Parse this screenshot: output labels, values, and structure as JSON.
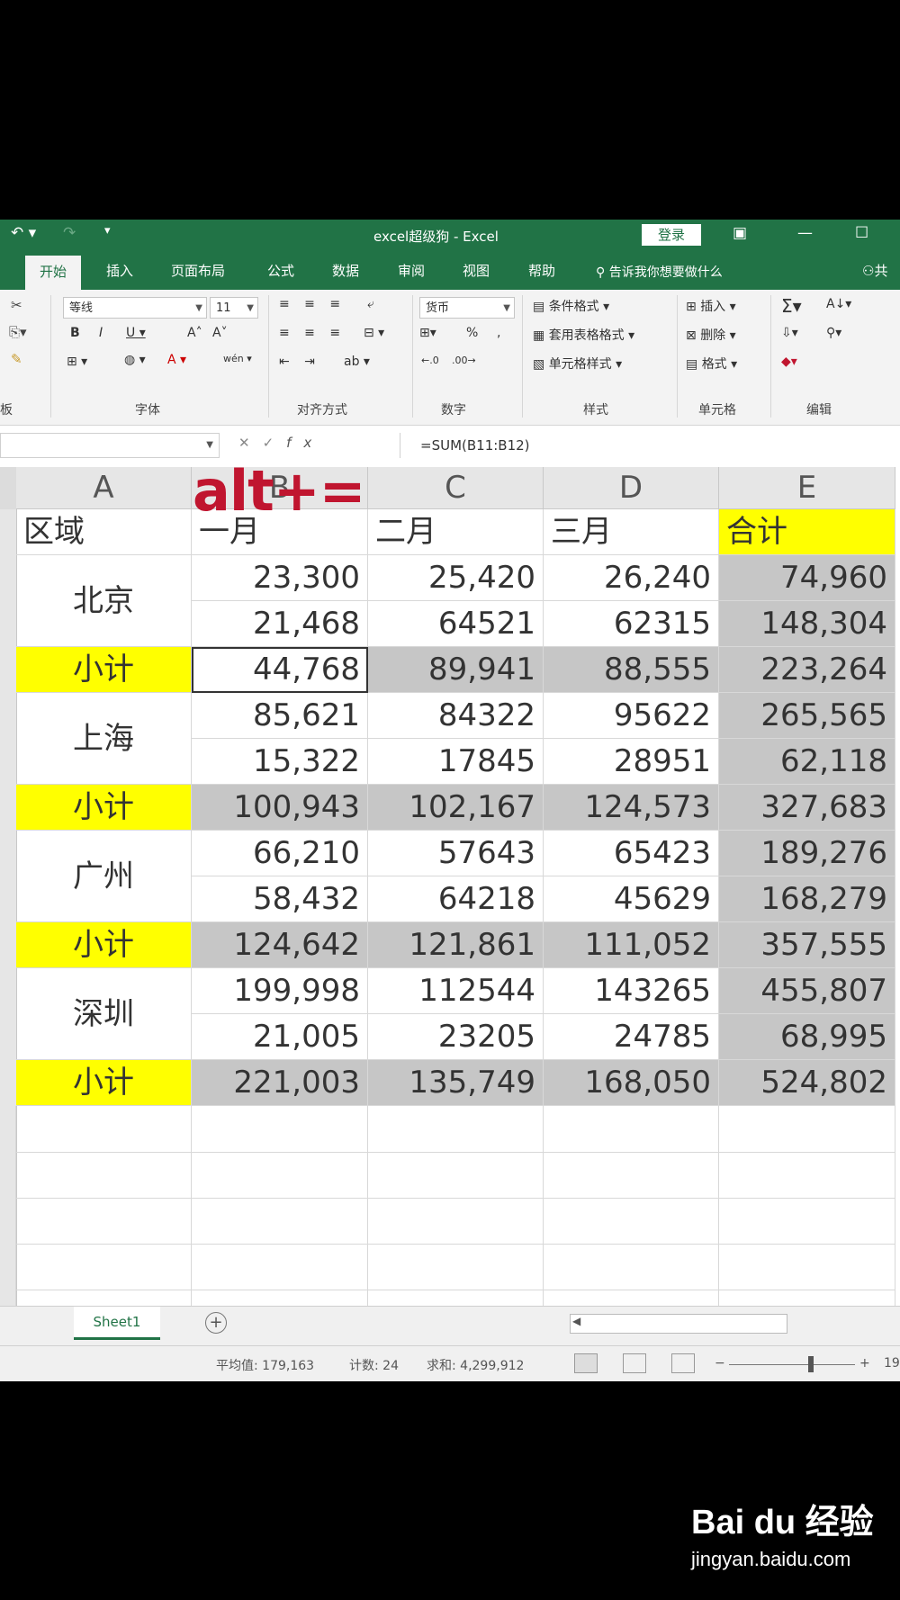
{
  "window": {
    "title": "excel超级狗 - Excel",
    "login": "登录"
  },
  "ribbon_tabs": [
    "开始",
    "插入",
    "页面布局",
    "公式",
    "数据",
    "审阅",
    "视图",
    "帮助"
  ],
  "tell_me": "告诉我你想要做什么",
  "share_fragment": "共",
  "ribbon": {
    "font_name": "等线",
    "font_size": "11",
    "number_format": "货币",
    "styles": [
      "条件格式",
      "套用表格格式",
      "单元格样式"
    ],
    "cells": [
      "插入",
      "删除",
      "格式"
    ],
    "group_labels": [
      "板",
      "字体",
      "对齐方式",
      "数字",
      "样式",
      "单元格",
      "编辑"
    ]
  },
  "formula_bar": {
    "formula": "=SUM(B11:B12)"
  },
  "shortcut_label": "alt+=",
  "grid": {
    "columns": [
      "A",
      "B",
      "C",
      "D",
      "E"
    ],
    "header_row": [
      "区域",
      "一月",
      "二月",
      "三月",
      "合计"
    ],
    "groups": [
      {
        "region": "北京",
        "rows": [
          [
            "23,300",
            "25,420",
            "26,240",
            "74,960"
          ],
          [
            "21,468",
            "64521",
            "62315",
            "148,304"
          ]
        ],
        "subtotal_label": "小计",
        "subtotal": [
          "44,768",
          "89,941",
          "88,555",
          "223,264"
        ]
      },
      {
        "region": "上海",
        "rows": [
          [
            "85,621",
            "84322",
            "95622",
            "265,565"
          ],
          [
            "15,322",
            "17845",
            "28951",
            "62,118"
          ]
        ],
        "subtotal_label": "小计",
        "subtotal": [
          "100,943",
          "102,167",
          "124,573",
          "327,683"
        ]
      },
      {
        "region": "广州",
        "rows": [
          [
            "66,210",
            "57643",
            "65423",
            "189,276"
          ],
          [
            "58,432",
            "64218",
            "45629",
            "168,279"
          ]
        ],
        "subtotal_label": "小计",
        "subtotal": [
          "124,642",
          "121,861",
          "111,052",
          "357,555"
        ]
      },
      {
        "region": "深圳",
        "rows": [
          [
            "199,998",
            "112544",
            "143265",
            "455,807"
          ],
          [
            "21,005",
            "23205",
            "24785",
            "68,995"
          ]
        ],
        "subtotal_label": "小计",
        "subtotal": [
          "221,003",
          "135,749",
          "168,050",
          "524,802"
        ]
      }
    ]
  },
  "sheet_tab": "Sheet1",
  "status": {
    "average": "平均值: 179,163",
    "count": "计数: 24",
    "sum": "求和: 4,299,912",
    "zoom_fragment": "19"
  },
  "watermark": {
    "brand": "Bai du 经验",
    "url": "jingyan.baidu.com"
  },
  "colors": {
    "excel_green": "#217346",
    "subtotal_yellow": "#ffff00",
    "selection_gray": "#c6c6c6",
    "shortcut_red": "#c0152f"
  }
}
